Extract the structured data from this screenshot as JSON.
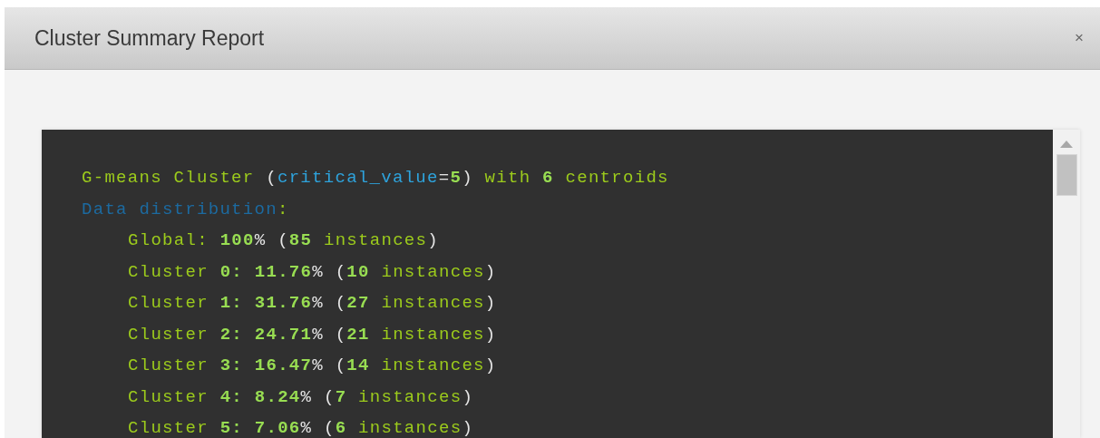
{
  "window": {
    "title": "Cluster Summary Report",
    "close": "×"
  },
  "report": {
    "summary": [
      {
        "text": "G-means Cluster ",
        "kind": "word"
      },
      {
        "text": "(",
        "kind": "punct"
      },
      {
        "text": "critical_value",
        "kind": "key"
      },
      {
        "text": "=",
        "kind": "punct"
      },
      {
        "text": "5",
        "kind": "number"
      },
      {
        "text": ")",
        "kind": "punct"
      },
      {
        "text": " with ",
        "kind": "word"
      },
      {
        "text": "6",
        "kind": "number"
      },
      {
        "text": " centroids",
        "kind": "word"
      }
    ],
    "distribution": {
      "heading": [
        {
          "text": "Data distribution",
          "kind": "heading"
        },
        {
          "text": ":",
          "kind": "word"
        }
      ],
      "children": [
        [
          {
            "text": "Global: ",
            "kind": "word"
          },
          {
            "text": "100",
            "kind": "number"
          },
          {
            "text": "% (",
            "kind": "punct"
          },
          {
            "text": "85",
            "kind": "number"
          },
          {
            "text": " instances",
            "kind": "word"
          },
          {
            "text": ")",
            "kind": "punct"
          }
        ],
        [
          {
            "text": "Cluster ",
            "kind": "word"
          },
          {
            "text": "0: 11.76",
            "kind": "number"
          },
          {
            "text": "% (",
            "kind": "punct"
          },
          {
            "text": "10",
            "kind": "number"
          },
          {
            "text": " instances",
            "kind": "word"
          },
          {
            "text": ")",
            "kind": "punct"
          }
        ],
        [
          {
            "text": "Cluster ",
            "kind": "word"
          },
          {
            "text": "1: 31.76",
            "kind": "number"
          },
          {
            "text": "% (",
            "kind": "punct"
          },
          {
            "text": "27",
            "kind": "number"
          },
          {
            "text": " instances",
            "kind": "word"
          },
          {
            "text": ")",
            "kind": "punct"
          }
        ],
        [
          {
            "text": "Cluster ",
            "kind": "word"
          },
          {
            "text": "2: 24.71",
            "kind": "number"
          },
          {
            "text": "% (",
            "kind": "punct"
          },
          {
            "text": "21",
            "kind": "number"
          },
          {
            "text": " instances",
            "kind": "word"
          },
          {
            "text": ")",
            "kind": "punct"
          }
        ],
        [
          {
            "text": "Cluster ",
            "kind": "word"
          },
          {
            "text": "3: 16.47",
            "kind": "number"
          },
          {
            "text": "% (",
            "kind": "punct"
          },
          {
            "text": "14",
            "kind": "number"
          },
          {
            "text": " instances",
            "kind": "word"
          },
          {
            "text": ")",
            "kind": "punct"
          }
        ],
        [
          {
            "text": "Cluster ",
            "kind": "word"
          },
          {
            "text": "4: 8.24",
            "kind": "number"
          },
          {
            "text": "% (",
            "kind": "punct"
          },
          {
            "text": "7",
            "kind": "number"
          },
          {
            "text": " instances",
            "kind": "word"
          },
          {
            "text": ")",
            "kind": "punct"
          }
        ],
        [
          {
            "text": "Cluster ",
            "kind": "word"
          },
          {
            "text": "5: 7.06",
            "kind": "number"
          },
          {
            "text": "% (",
            "kind": "punct"
          },
          {
            "text": "6",
            "kind": "number"
          },
          {
            "text": " instances",
            "kind": "word"
          },
          {
            "text": ")",
            "kind": "punct"
          }
        ]
      ]
    }
  }
}
